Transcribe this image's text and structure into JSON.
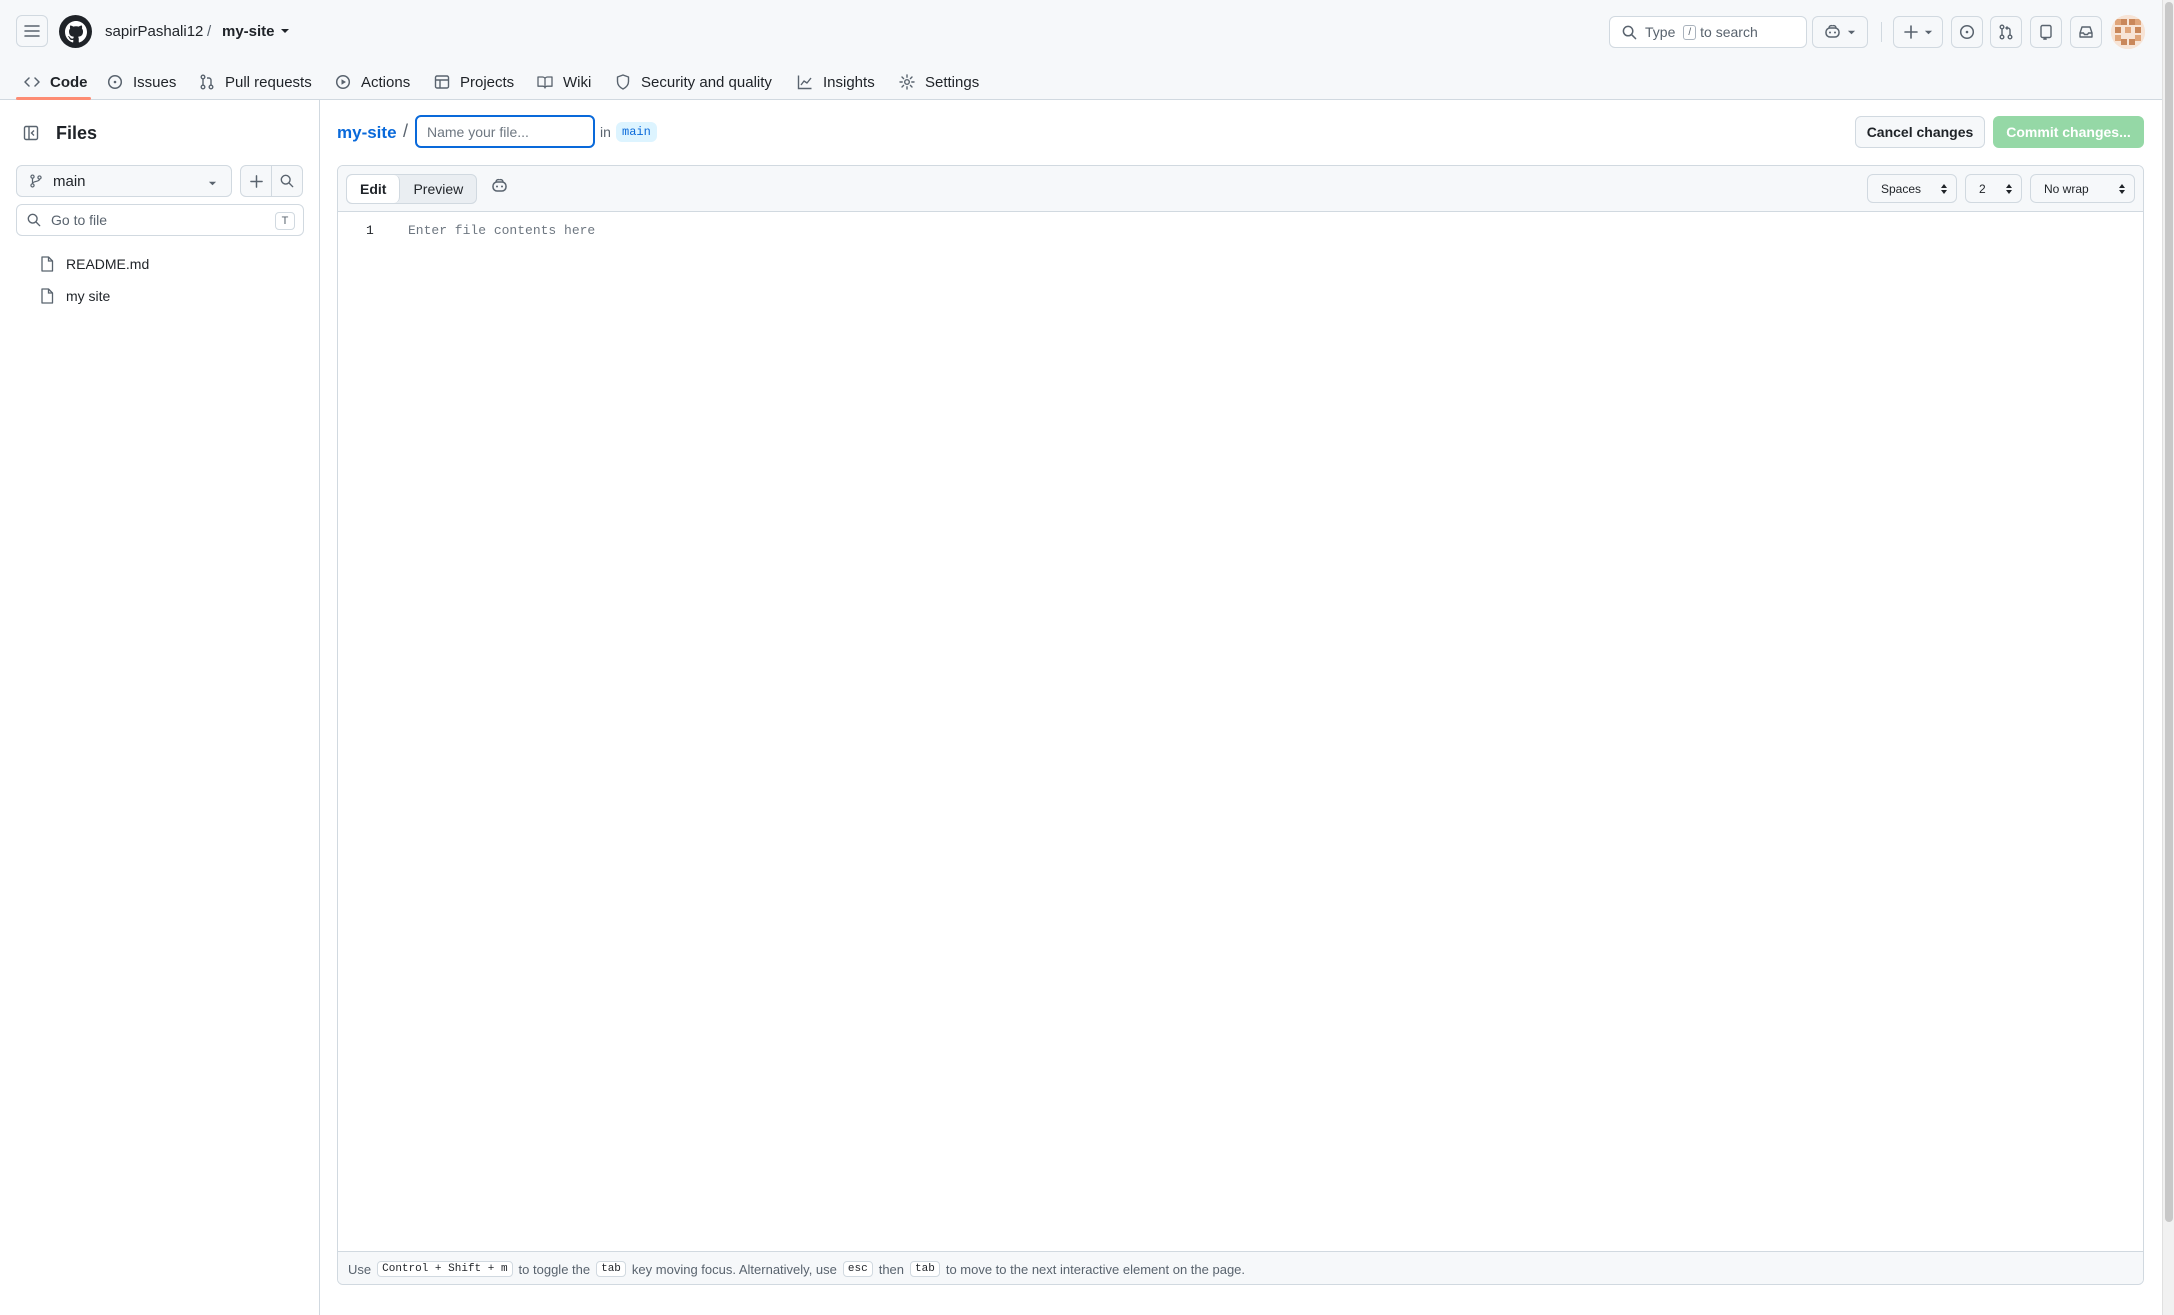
{
  "header": {
    "owner": "sapirPashali12",
    "separator": "/",
    "repo": "my-site",
    "search": {
      "prefix": "Type",
      "key": "/",
      "suffix": "to search"
    }
  },
  "nav": {
    "items": [
      {
        "label": "Code",
        "icon": "code-icon",
        "active": true
      },
      {
        "label": "Issues",
        "icon": "issue-opened-icon"
      },
      {
        "label": "Pull requests",
        "icon": "git-pull-request-icon"
      },
      {
        "label": "Actions",
        "icon": "play-icon"
      },
      {
        "label": "Projects",
        "icon": "table-icon"
      },
      {
        "label": "Wiki",
        "icon": "book-icon"
      },
      {
        "label": "Security and quality",
        "icon": "shield-icon"
      },
      {
        "label": "Insights",
        "icon": "graph-icon"
      },
      {
        "label": "Settings",
        "icon": "gear-icon"
      }
    ]
  },
  "sidebar": {
    "title": "Files",
    "branch": "main",
    "goto_placeholder": "Go to file",
    "goto_shortcut": "T",
    "files": [
      {
        "name": "README.md",
        "icon": "file-icon"
      },
      {
        "name": "my site",
        "icon": "file-icon"
      }
    ]
  },
  "editor": {
    "repo_link": "my-site",
    "path_separator": "/",
    "filename_placeholder": "Name your file...",
    "in_word": "in",
    "branch": "main",
    "cancel_label": "Cancel changes",
    "commit_label": "Commit changes...",
    "tabs": {
      "edit": "Edit",
      "preview": "Preview"
    },
    "indent_mode": "Spaces",
    "indent_size": "2",
    "wrap_mode": "No wrap",
    "line_number": "1",
    "content_placeholder": "Enter file contents here"
  },
  "footer": {
    "t1": "Use",
    "k1": "Control + Shift + m",
    "t2": "to toggle the",
    "k2": "tab",
    "t3": "key moving focus. Alternatively, use",
    "k3": "esc",
    "t4": "then",
    "k4": "tab",
    "t5": "to move to the next interactive element on the page."
  },
  "colors": {
    "link": "#0969da",
    "commit_disabled": "#95d8a6",
    "active_tab_underline": "#fd8c73",
    "border": "#d1d9e0",
    "header_bg": "#f6f8fa"
  }
}
